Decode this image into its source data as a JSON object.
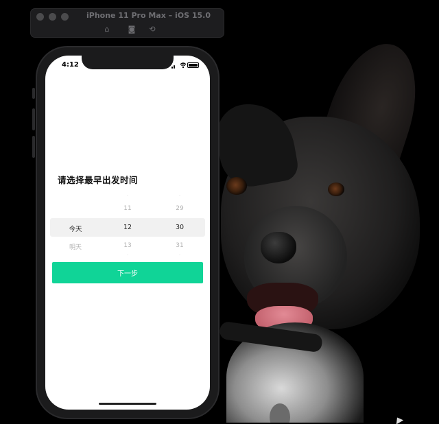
{
  "simulator": {
    "title": "iPhone 11 Pro Max – iOS 15.0",
    "toolbar": {
      "home_icon": "⌂",
      "screenshot_icon": "◙",
      "rotate_icon": "⟲"
    }
  },
  "status_bar": {
    "time": "4:12"
  },
  "page": {
    "title": "请选择最早出发时间",
    "picker": {
      "day": {
        "above": "",
        "selected": "今天",
        "below": "明天"
      },
      "hour": {
        "above2": "·",
        "above": "11",
        "selected": "12",
        "below": "13",
        "below2": "·"
      },
      "minute": {
        "above2": "·",
        "above": "29",
        "selected": "30",
        "below": "31",
        "below2": "·"
      }
    },
    "next_button": "下一步"
  },
  "colors": {
    "accent": "#10d497",
    "picker_highlight": "#f1f1f1",
    "desktop": "#000000"
  }
}
